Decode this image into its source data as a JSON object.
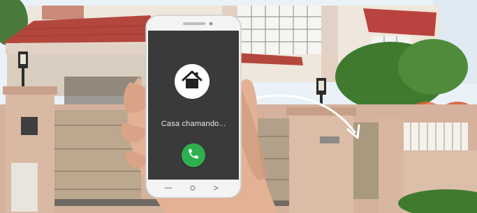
{
  "phone": {
    "caller_text": "Casa chamando...",
    "caller_icon": "house-icon",
    "answer_icon": "phone-handset-icon"
  },
  "colors": {
    "answer_button": "#2fb04e",
    "screen": "#3a3a3a",
    "gate_wall": "#d9b9a4",
    "roof_tiles": "#b5483e",
    "sky": "#e8f1f8"
  }
}
